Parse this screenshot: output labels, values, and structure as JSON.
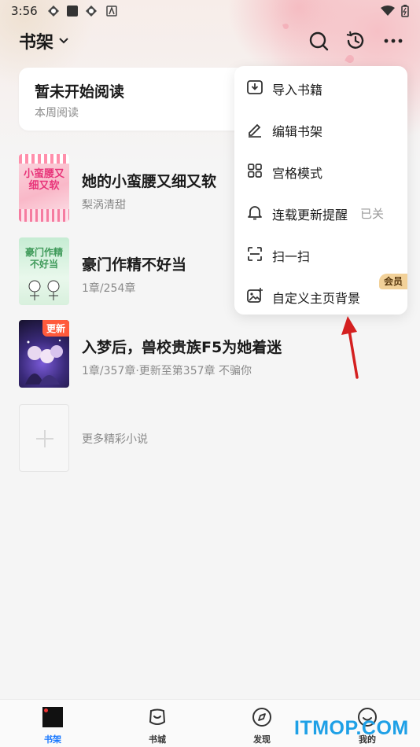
{
  "status_bar": {
    "time": "3:56"
  },
  "header": {
    "title": "书架"
  },
  "reading_card": {
    "title": "暂未开始阅读",
    "subtitle": "本周阅读"
  },
  "books": [
    {
      "title": "她的小蛮腰又细又软",
      "meta": "梨涡清甜",
      "cover_text": "小蛮腰又细又软",
      "badge": ""
    },
    {
      "title": "豪门作精不好当",
      "meta": "1章/254章",
      "cover_text": "豪门作精不好当",
      "badge": ""
    },
    {
      "title": "入梦后，兽校贵族F5为她着迷",
      "meta": "1章/357章·更新至第357章 不骗你",
      "cover_text": "",
      "badge": "更新"
    }
  ],
  "more_label": "更多精彩小说",
  "menu": {
    "items": [
      {
        "label": "导入书籍",
        "icon": "import-icon",
        "status": ""
      },
      {
        "label": "编辑书架",
        "icon": "edit-icon",
        "status": ""
      },
      {
        "label": "宫格模式",
        "icon": "grid-icon",
        "status": ""
      },
      {
        "label": "连载更新提醒",
        "icon": "bell-icon",
        "status": "已关"
      },
      {
        "label": "扫一扫",
        "icon": "scan-icon",
        "status": ""
      },
      {
        "label": "自定义主页背景",
        "icon": "image-icon",
        "status": ""
      }
    ],
    "vip_badge": "会员"
  },
  "bottom_nav": {
    "items": [
      {
        "label": "书架",
        "icon": "bookshelf-icon",
        "active": true
      },
      {
        "label": "书城",
        "icon": "store-icon",
        "active": false
      },
      {
        "label": "发现",
        "icon": "compass-icon",
        "active": false
      },
      {
        "label": "我的",
        "icon": "profile-icon",
        "active": false
      }
    ]
  },
  "watermark": "ITMOP.COM",
  "colors": {
    "accent": "#1677ff",
    "update_badge": "#ff5a3c",
    "vip_badge": "#f2d199",
    "arrow": "#d42020"
  }
}
